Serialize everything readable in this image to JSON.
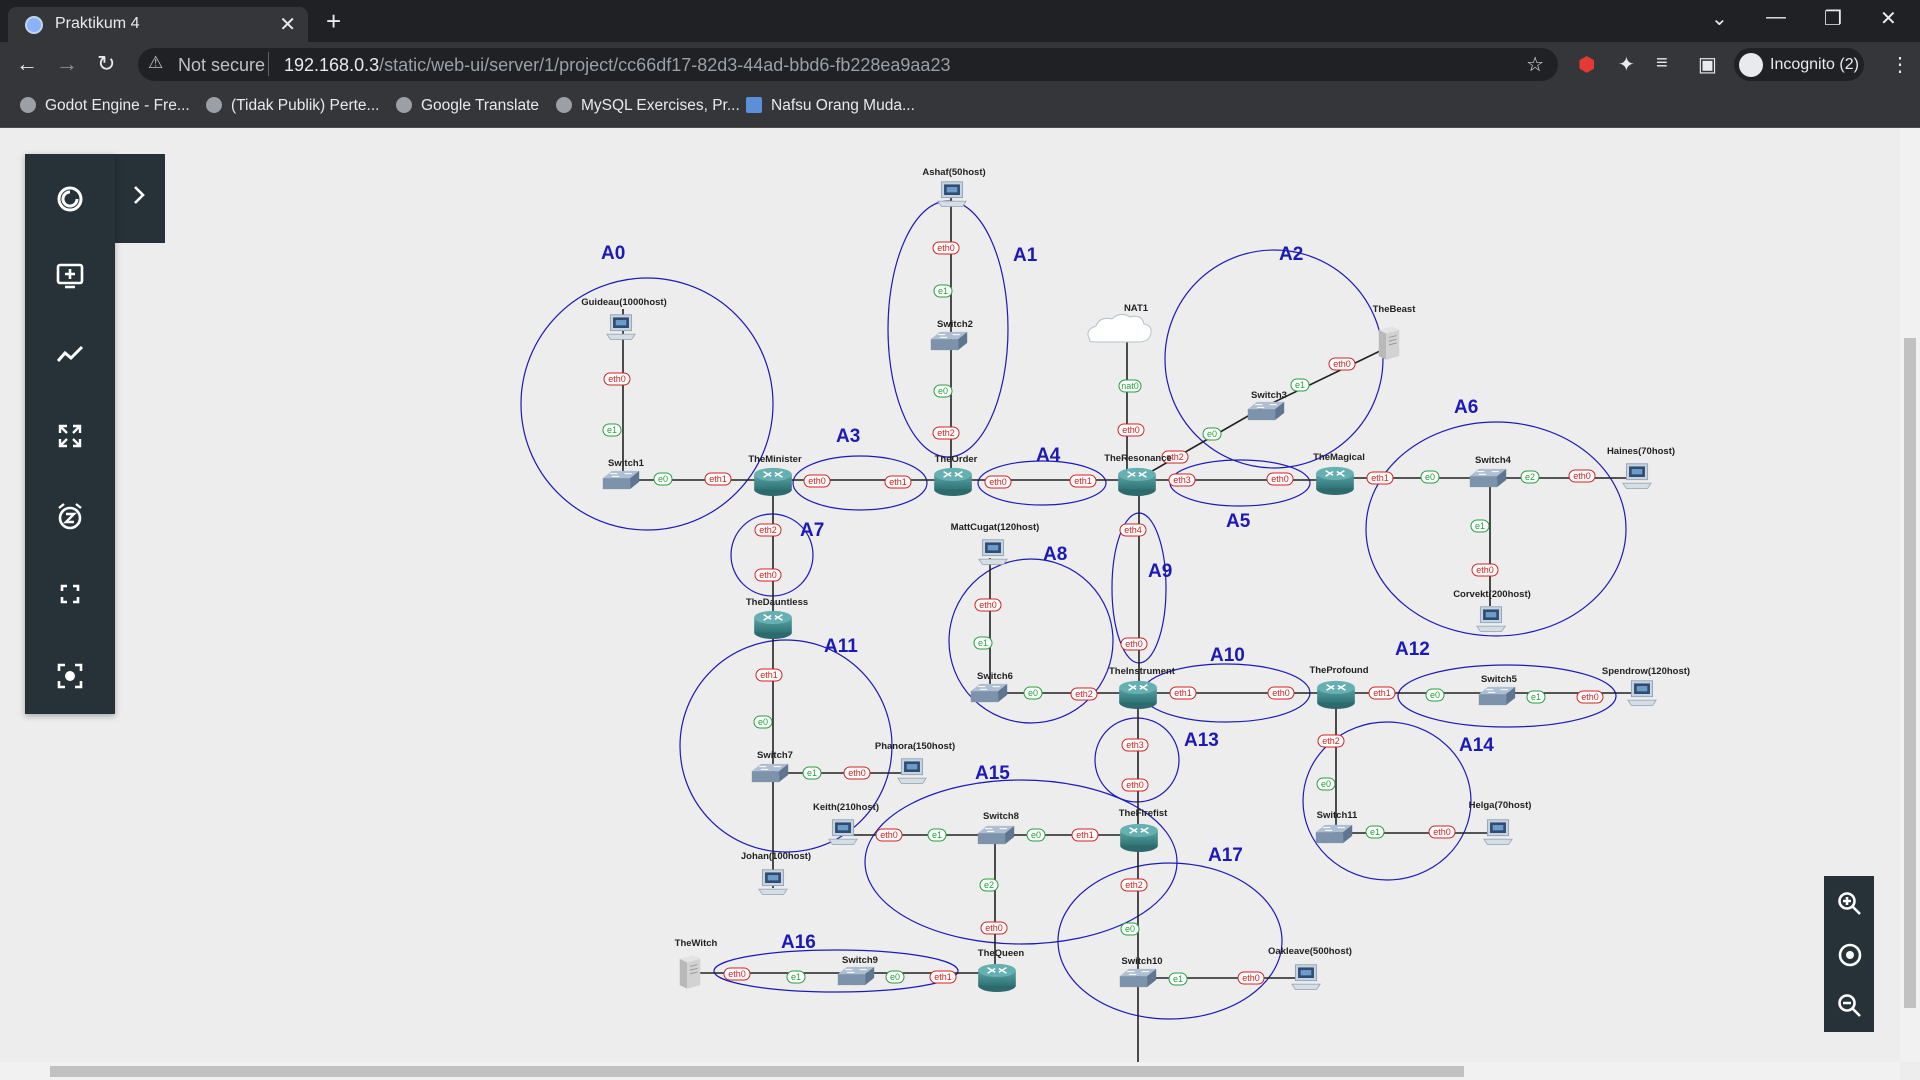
{
  "browser": {
    "tab_title": "Praktikum 4",
    "tab_close": "✕",
    "new_tab": "+",
    "security_label": "Not secure",
    "url_host": "192.168.0.3",
    "url_path": "/static/web-ui/server/1/project/cc66df17-82d3-44ad-bbd6-fb228ea9aa23",
    "profile_label": "Incognito (2)"
  },
  "bookmarks": [
    {
      "label": "Godot Engine - Fre..."
    },
    {
      "label": "(Tidak Publik) Perte..."
    },
    {
      "label": "Google Translate"
    },
    {
      "label": "MySQL Exercises, Pr..."
    },
    {
      "label": "Nafsu Orang Muda..."
    }
  ],
  "topology": {
    "areas": [
      "A0",
      "A1",
      "A2",
      "A3",
      "A4",
      "A5",
      "A6",
      "A7",
      "A8",
      "A9",
      "A10",
      "A11",
      "A12",
      "A13",
      "A14",
      "A15",
      "A16",
      "A17"
    ],
    "nodes": {
      "ashaf": "Ashaf(50host)",
      "guideau": "Guideau(1000host)",
      "nat1": "NAT1",
      "thebeast": "TheBeast",
      "switch2": "Switch2",
      "switch3": "Switch3",
      "switch1": "Switch1",
      "theminister": "TheMinister",
      "theorder": "TheOrder",
      "theresonance": "TheResonance",
      "themagical": "TheMagical",
      "switch4": "Switch4",
      "haines": "Haines(70host)",
      "corvekt": "Corvekt(200host)",
      "mattcugat": "MattCugat(120host)",
      "thedauntless": "TheDauntless",
      "switch6": "Switch6",
      "theinstrument": "TheInstrument",
      "theprofound": "TheProfound",
      "switch5": "Switch5",
      "spendrow": "Spendrow(120host)",
      "switch7": "Switch7",
      "phanora": "Phanora(150host)",
      "keith": "Keith(210host)",
      "switch8": "Switch8",
      "thefirefist": "TheFirefist",
      "helga": "Helga(70host)",
      "switch11": "Switch11",
      "johan": "Johan(100host)",
      "thewitch": "TheWitch",
      "switch9": "Switch9",
      "thequeen": "TheQueen",
      "switch10": "Switch10",
      "oakleave": "Oakleave(500host)"
    }
  },
  "icons": {
    "tools": [
      "gns3-logo-icon",
      "expand-chevron-icon",
      "add-node-icon",
      "traffic-graph-icon",
      "fit-screen-icon",
      "snooze-icon",
      "fullscreen-icon",
      "screenshot-icon"
    ],
    "zoom": [
      "zoom-in-icon",
      "reset-zoom-icon",
      "zoom-out-icon"
    ]
  },
  "colors": {
    "area_outline": "#1d19b8",
    "port_red": "#d42020",
    "port_green": "#22a03a",
    "router": "#3c8a8c",
    "panel": "#263238"
  }
}
